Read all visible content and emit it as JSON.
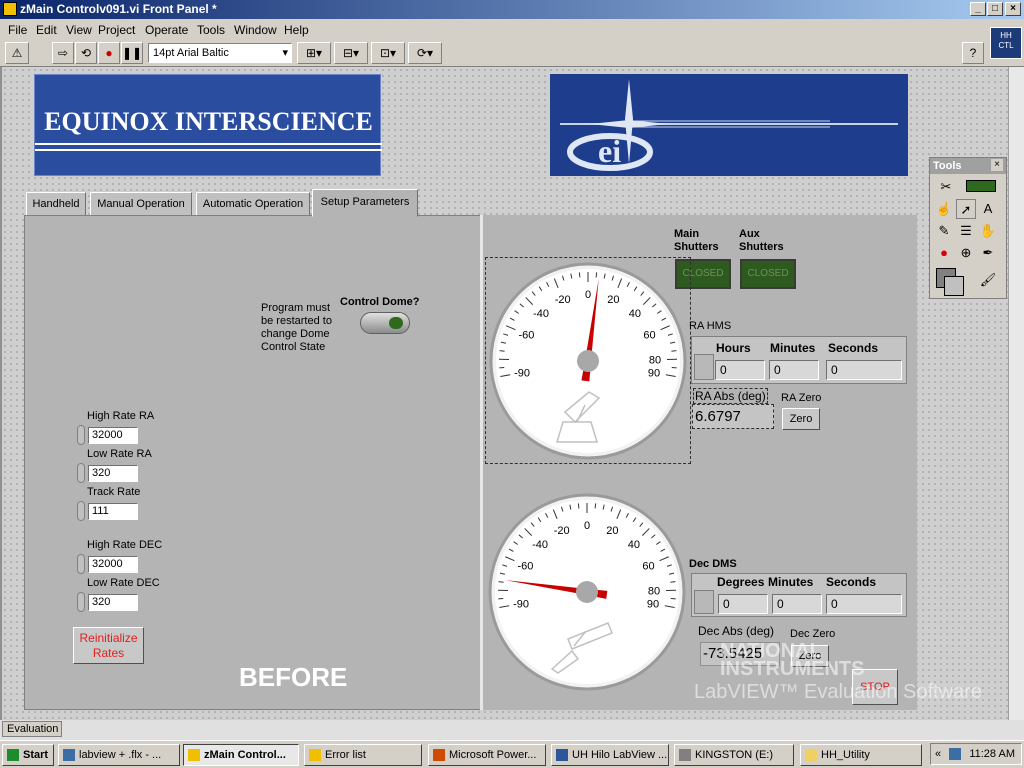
{
  "window": {
    "title": "zMain Controlv091.vi Front Panel *",
    "min": "_",
    "max": "□",
    "close": "×"
  },
  "menu": [
    "File",
    "Edit",
    "View",
    "Project",
    "Operate",
    "Tools",
    "Window",
    "Help"
  ],
  "toolbar": {
    "font": "14pt Arial Baltic",
    "help": "?"
  },
  "ctl_icon": {
    "l1": "HH",
    "l2": "CTL"
  },
  "banner": {
    "text": "EQUINOX INTERSCIENCE"
  },
  "tabs": [
    "Handheld",
    "Manual Operation",
    "Automatic Operation",
    "Setup Parameters"
  ],
  "setup": {
    "program_note": "Program must be restarted to change Dome Control State",
    "control_dome_label": "Control Dome?",
    "high_rate_ra_label": "High Rate RA",
    "high_rate_ra": "32000",
    "low_rate_ra_label": "Low Rate RA",
    "low_rate_ra": "320",
    "track_rate_label": "Track Rate",
    "track_rate": "111",
    "high_rate_dec_label": "High Rate DEC",
    "high_rate_dec": "32000",
    "low_rate_dec_label": "Low Rate DEC",
    "low_rate_dec": "320",
    "reinit_label": "Reinitialize Rates",
    "before": "BEFORE"
  },
  "shutters": {
    "main_label": "Main Shutters",
    "aux_label": "Aux Shutters",
    "main_state": "CLOSED",
    "aux_state": "CLOSED"
  },
  "ra": {
    "title": "RA HMS",
    "h_hdr": "Hours",
    "m_hdr": "Minutes",
    "s_hdr": "Seconds",
    "hours": "0",
    "minutes": "0",
    "seconds": "0",
    "abs_label": "RA Abs (deg)",
    "abs": "6.6797",
    "zero_label": "RA Zero",
    "zero_btn": "Zero"
  },
  "dec": {
    "title": "Dec DMS",
    "d_hdr": "Degrees",
    "m_hdr": "Minutes",
    "s_hdr": "Seconds",
    "degrees": "0",
    "minutes": "0",
    "seconds": "0",
    "abs_label": "Dec Abs (deg)",
    "abs": "-73.5425",
    "zero_label": "Dec Zero",
    "zero_btn": "Zero"
  },
  "gauge_ticks": [
    "-90",
    "-60",
    "-40",
    "-20",
    "0",
    "20",
    "40",
    "60",
    "80",
    "90"
  ],
  "gauge_values": {
    "ra": 6.6797,
    "dec": -73.5425
  },
  "stop": "STOP",
  "watermark": {
    "l1": "NATIONAL",
    "l2": "INSTRUMENTS",
    "l3": "LabVIEW™ Evaluation Software"
  },
  "status": {
    "mode": "Evaluation"
  },
  "tools_palette": {
    "title": "Tools"
  },
  "taskbar": {
    "start": "Start",
    "tasks": [
      "labview + .flx - ...",
      "zMain Control...",
      "Error list",
      "Microsoft Power...",
      "UH Hilo LabView ...",
      "KINGSTON (E:)",
      "HH_Utility"
    ],
    "clock": "11:28 AM"
  }
}
